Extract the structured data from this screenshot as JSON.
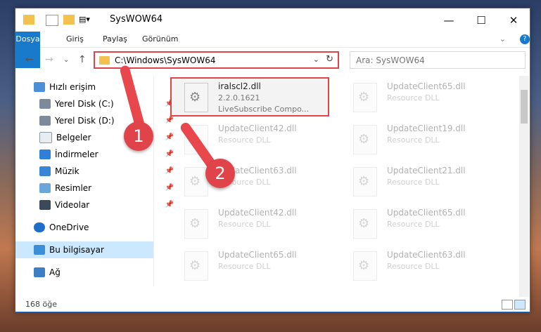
{
  "window": {
    "title": "SysWOW64"
  },
  "ribbon": {
    "tabs": [
      "Dosya",
      "Giriş",
      "Paylaş",
      "Görünüm"
    ]
  },
  "address": {
    "path": "C:\\Windows\\SysWOW64",
    "search_placeholder": "Ara: SysWOW64"
  },
  "sidebar": {
    "items": [
      {
        "label": "Hızlı erişim",
        "icon": "star-icon"
      },
      {
        "label": "Yerel Disk (C:)",
        "icon": "drive-icon",
        "pinned": true
      },
      {
        "label": "Yerel Disk (D:)",
        "icon": "drive-icon",
        "pinned": true
      },
      {
        "label": "Belgeler",
        "icon": "document-icon",
        "pinned": true
      },
      {
        "label": "İndirmeler",
        "icon": "download-icon",
        "pinned": true
      },
      {
        "label": "Müzik",
        "icon": "music-icon",
        "pinned": true
      },
      {
        "label": "Resimler",
        "icon": "pictures-icon",
        "pinned": true
      },
      {
        "label": "Videolar",
        "icon": "video-icon",
        "pinned": true
      },
      {
        "label": "OneDrive",
        "icon": "cloud-icon"
      },
      {
        "label": "Bu bilgisayar",
        "icon": "computer-icon",
        "selected": true
      },
      {
        "label": "Ağ",
        "icon": "network-icon"
      }
    ]
  },
  "files": {
    "highlighted": {
      "name": "iralscl2.dll",
      "version": "2.2.0.1621",
      "desc": "LiveSubscribe Compo..."
    },
    "right": [
      {
        "name": "UpdateClient65.dll",
        "desc": "Resource DLL"
      },
      {
        "name": "UpdateClient19.dll",
        "desc": "Resource DLL"
      },
      {
        "name": "UpdateClient21.dll",
        "desc": "Resource DLL"
      },
      {
        "name": "UpdateClient65.dll",
        "desc": "Resource DLL"
      },
      {
        "name": "UpdateClient63.dll",
        "desc": "Resource DLL"
      }
    ],
    "left": [
      {
        "name": "UpdateClient42.dll",
        "desc": "Resource DLL"
      },
      {
        "name": "UpdateClient63.dll",
        "desc": "Resource DLL"
      },
      {
        "name": "UpdateClient42.dll",
        "desc": "Resource DLL"
      },
      {
        "name": "UpdateClient65.dll",
        "desc": "Resource DLL"
      }
    ]
  },
  "status": {
    "count": "168 öğe"
  },
  "annotations": {
    "badge1": "1",
    "badge2": "2"
  },
  "colors": {
    "accent": "#1979ca",
    "highlight": "#e0444a"
  }
}
